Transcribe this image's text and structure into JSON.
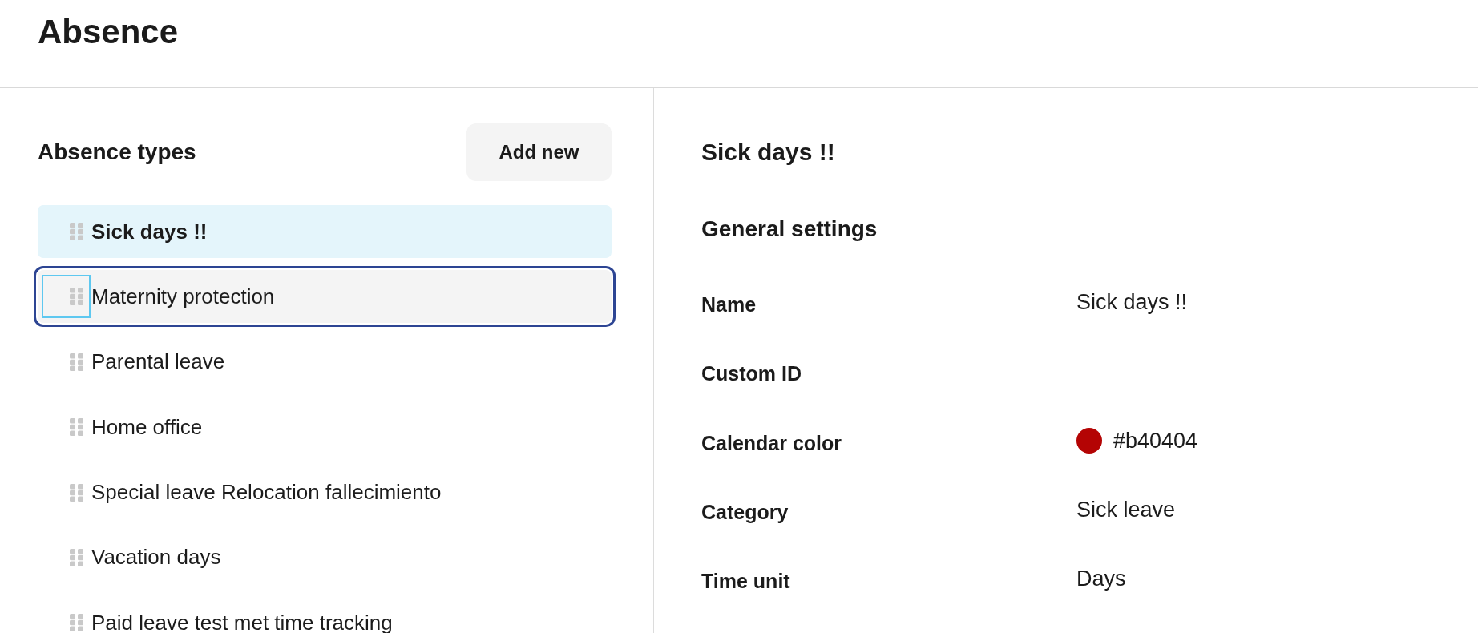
{
  "page": {
    "title": "Absence"
  },
  "absence_types": {
    "title": "Absence types",
    "add_button": "Add new",
    "items": [
      {
        "label": "Sick days !!",
        "selected": true,
        "focused": false,
        "handle_focused": false
      },
      {
        "label": "Maternity protection",
        "selected": false,
        "focused": true,
        "handle_focused": true
      },
      {
        "label": "Parental leave",
        "selected": false,
        "focused": false,
        "handle_focused": false
      },
      {
        "label": "Home office",
        "selected": false,
        "focused": false,
        "handle_focused": false
      },
      {
        "label": "Special leave Relocation fallecimiento",
        "selected": false,
        "focused": false,
        "handle_focused": false
      },
      {
        "label": "Vacation days",
        "selected": false,
        "focused": false,
        "handle_focused": false
      },
      {
        "label": "Paid leave test met time tracking",
        "selected": false,
        "focused": false,
        "handle_focused": false
      }
    ]
  },
  "detail": {
    "title": "Sick days !!",
    "section": "General settings",
    "fields": [
      {
        "kind": "text",
        "label": "Name",
        "value": "Sick days !!"
      },
      {
        "kind": "text",
        "label": "Custom ID"
      },
      {
        "kind": "color",
        "label": "Calendar color",
        "value": "#b40404",
        "color": "#b40404"
      },
      {
        "kind": "text",
        "label": "Category",
        "value": "Sick leave"
      },
      {
        "kind": "text",
        "label": "Time unit",
        "value": "Days"
      }
    ]
  }
}
